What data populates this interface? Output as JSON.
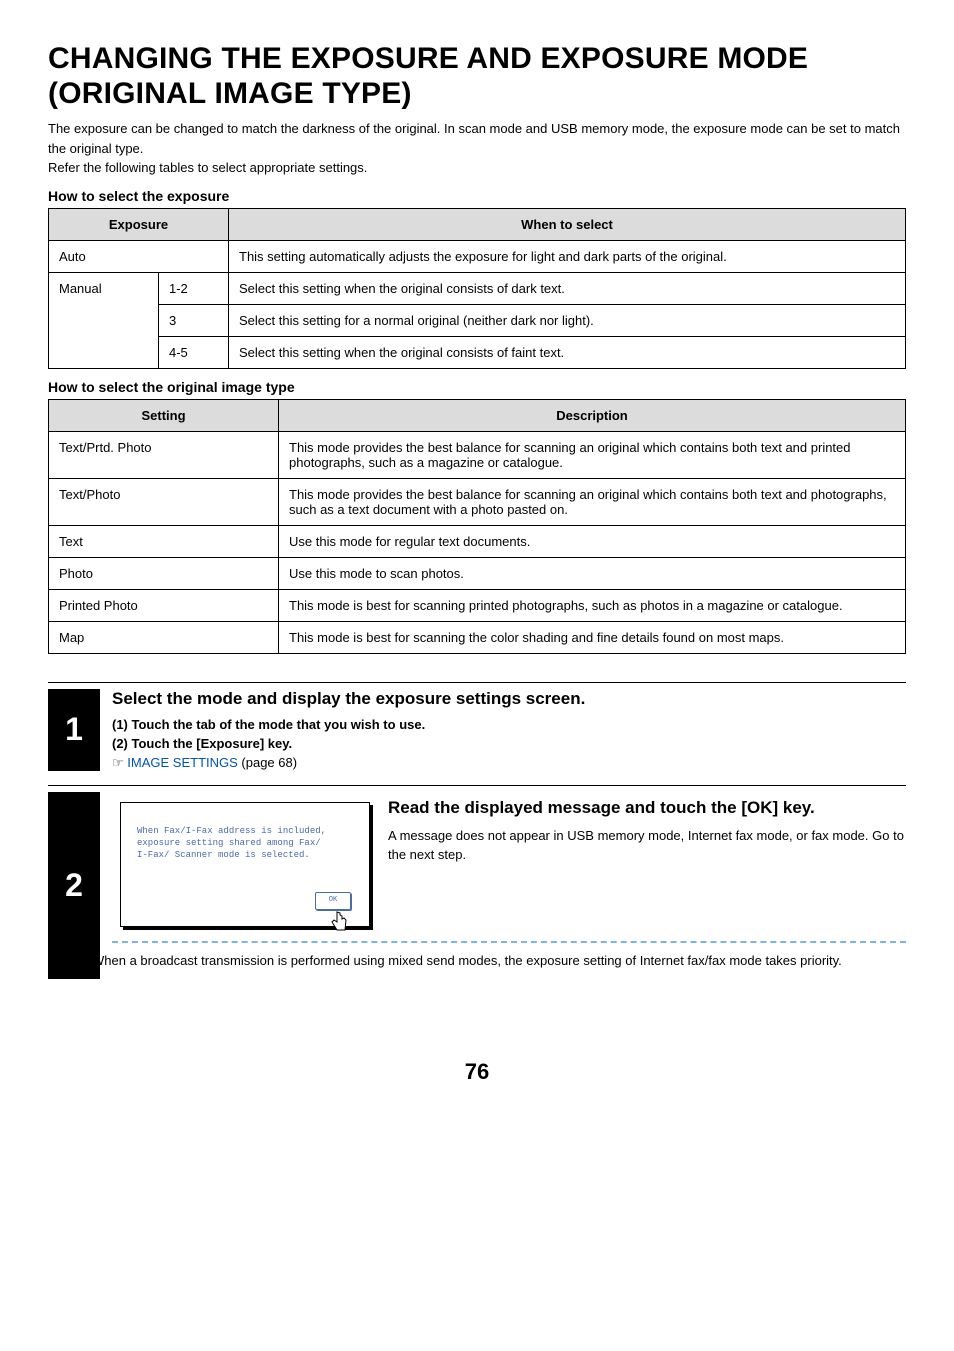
{
  "title": "CHANGING THE EXPOSURE AND EXPOSURE MODE (ORIGINAL IMAGE TYPE)",
  "intro": "The exposure can be changed to match the darkness of the original. In scan mode and USB memory mode, the exposure mode can be set to match the original type.\nRefer the following tables to select appropriate settings.",
  "section1_heading": "How to select the exposure",
  "table1": {
    "headers": {
      "left": "Exposure",
      "right": "When to select"
    },
    "rows": [
      {
        "name": "Auto",
        "sub": "",
        "desc": "This setting automatically adjusts the exposure for light and dark parts of the original."
      },
      {
        "name": "Manual",
        "sub": "1-2",
        "desc": "Select this setting when the original consists of dark text."
      },
      {
        "name": "",
        "sub": "3",
        "desc": "Select this setting for a normal original (neither dark nor light)."
      },
      {
        "name": "",
        "sub": "4-5",
        "desc": "Select this setting when the original consists of faint text."
      }
    ]
  },
  "section2_heading": "How to select the original image type",
  "table2": {
    "headers": {
      "left": "Setting",
      "right": "Description"
    },
    "rows": [
      {
        "setting": "Text/Prtd. Photo",
        "desc": "This mode provides the best balance for scanning an original which contains both text and printed photographs, such as a magazine or catalogue."
      },
      {
        "setting": "Text/Photo",
        "desc": "This mode provides the best balance for scanning an original which contains both text and photographs, such as a text document with a photo pasted on."
      },
      {
        "setting": "Text",
        "desc": "Use this mode for regular text documents."
      },
      {
        "setting": "Photo",
        "desc": "Use this mode to scan photos."
      },
      {
        "setting": "Printed Photo",
        "desc": "This mode is best for scanning printed photographs, such as photos in a magazine or catalogue."
      },
      {
        "setting": "Map",
        "desc": "This mode is best for scanning the color shading and fine details found on most maps."
      }
    ]
  },
  "step1": {
    "num": "1",
    "title": "Select the mode and display the exposure settings screen.",
    "sub1": "(1)  Touch the tab of the mode that you wish to use.",
    "sub2": "(2)  Touch the [Exposure] key.",
    "xref_glyph": "☞",
    "xref_link": "IMAGE SETTINGS",
    "xref_tail": " (page 68)"
  },
  "step2": {
    "num": "2",
    "dialog_line1": "When Fax/I-Fax address is included,",
    "dialog_line2": "exposure setting shared among Fax/",
    "dialog_line3": "I-Fax/ Scanner mode is selected.",
    "ok_label": "OK",
    "title": "Read the displayed message and touch the [OK] key.",
    "desc": "A message does not appear in USB memory mode, Internet fax mode, or fax mode. Go to the next step.",
    "note": "When a broadcast transmission is performed using mixed send modes, the exposure setting of Internet fax/fax mode takes priority."
  },
  "page_number": "76"
}
